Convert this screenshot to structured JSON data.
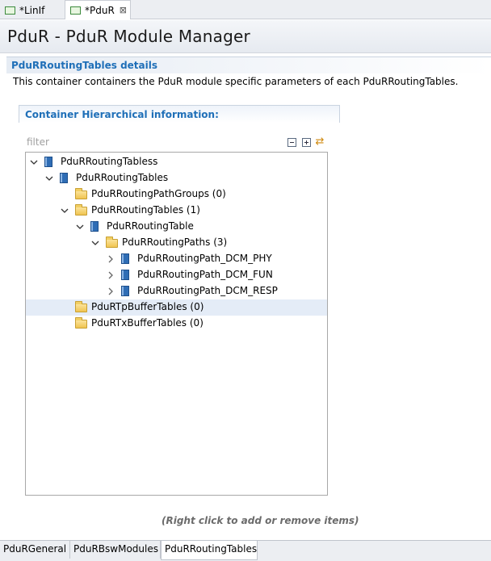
{
  "editor_tabs": [
    {
      "label": "*LinIf",
      "icon": "module-icon"
    },
    {
      "label": "*PduR",
      "icon": "module-icon",
      "close": "⊠"
    }
  ],
  "header": {
    "title": "PduR - PduR Module Manager"
  },
  "details": {
    "title": "PduRRoutingTables details",
    "description": "This container containers the PduR module specific parameters of each PduRRoutingTables."
  },
  "hierarchy": {
    "title": "Container Hierarchical information:",
    "filter_placeholder": "filter",
    "tools": {
      "collapse": "collapse-all",
      "expand": "expand-all",
      "sync": "⇄"
    }
  },
  "tree": [
    {
      "label": "PduRRoutingTabless",
      "icon": "container",
      "twisty": "expanded"
    },
    {
      "label": "PduRRoutingTables",
      "icon": "container",
      "twisty": "expanded"
    },
    {
      "label": "PduRRoutingPathGroups (0)",
      "icon": "folder",
      "twisty": "none"
    },
    {
      "label": "PduRRoutingTables (1)",
      "icon": "folder",
      "twisty": "expanded"
    },
    {
      "label": "PduRRoutingTable",
      "icon": "container",
      "twisty": "expanded"
    },
    {
      "label": "PduRRoutingPaths (3)",
      "icon": "folder",
      "twisty": "expanded"
    },
    {
      "label": "PduRRoutingPath_DCM_PHY",
      "icon": "container",
      "twisty": "collapsed"
    },
    {
      "label": "PduRRoutingPath_DCM_FUN",
      "icon": "container",
      "twisty": "collapsed"
    },
    {
      "label": "PduRRoutingPath_DCM_RESP",
      "icon": "container",
      "twisty": "collapsed"
    },
    {
      "label": "PduRTpBufferTables (0)",
      "icon": "folder",
      "twisty": "none",
      "selected": true
    },
    {
      "label": "PduRTxBufferTables (0)",
      "icon": "folder",
      "twisty": "none"
    }
  ],
  "hint": "(Right click to add or remove items)",
  "page_tabs": [
    {
      "label": "PduRGeneral"
    },
    {
      "label": "PduRBswModules"
    },
    {
      "label": "PduRRoutingTables",
      "active": true
    }
  ],
  "colors": {
    "accent": "#1f6fb8",
    "selection": "#e4ecf7",
    "folder": "#f0c451",
    "container": "#2f6db5"
  }
}
